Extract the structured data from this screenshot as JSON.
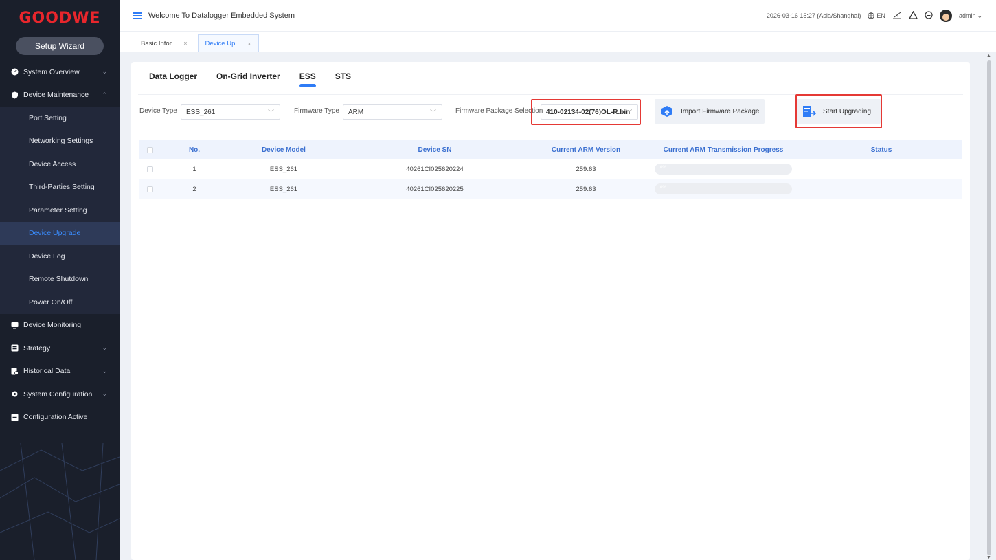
{
  "brand": {
    "logo": "GOODWE",
    "setup_wizard": "Setup Wizard"
  },
  "sidebar": {
    "items": [
      {
        "label": "System Overview",
        "icon": "speedometer-icon",
        "chevron": "⌄"
      },
      {
        "label": "Device Maintenance",
        "icon": "shield-icon",
        "chevron": "⌃"
      }
    ],
    "maintenance_sub": [
      "Port Setting",
      "Networking Settings",
      "Device Access",
      "Third-Parties Setting",
      "Parameter Setting",
      "Device Upgrade",
      "Device Log",
      "Remote Shutdown",
      "Power On/Off"
    ],
    "lower_items": [
      {
        "label": "Device Monitoring",
        "icon": "monitor-icon",
        "chevron": ""
      },
      {
        "label": "Strategy",
        "icon": "strategy-icon",
        "chevron": "⌄"
      },
      {
        "label": "Historical Data",
        "icon": "history-icon",
        "chevron": "⌄"
      },
      {
        "label": "System Configuration",
        "icon": "gear-icon",
        "chevron": "⌄"
      },
      {
        "label": "Configuration Active",
        "icon": "config-icon",
        "chevron": ""
      }
    ]
  },
  "header": {
    "title": "Welcome To Datalogger Embedded System",
    "datetime": "2026-03-16 15:27 (Asia/Shanghai)",
    "language": "EN",
    "user": "admin"
  },
  "tabs": [
    {
      "label": "Basic Infor...",
      "close": "×"
    },
    {
      "label": "Device Up...",
      "close": "×"
    }
  ],
  "subtabs": [
    "Data Logger",
    "On-Grid Inverter",
    "ESS",
    "STS"
  ],
  "filters": {
    "device_type_label": "Device Type",
    "device_type_value": "ESS_261",
    "firmware_type_label": "Firmware Type",
    "firmware_type_value": "ARM",
    "package_label": "Firmware Package Selection",
    "package_value": "410-02134-02(76)OL-R.bin",
    "import_button": "Import Firmware Package",
    "start_button": "Start Upgrading"
  },
  "table": {
    "headers": [
      "No.",
      "Device Model",
      "Device SN",
      "Current ARM Version",
      "Current ARM Transmission Progress",
      "Status"
    ],
    "rows": [
      {
        "no": "1",
        "model": "ESS_261",
        "sn": "40261CI025620224",
        "arm": "259.63",
        "progress": 0.0,
        "progress_text": "0%",
        "status": ""
      },
      {
        "no": "2",
        "model": "ESS_261",
        "sn": "40261CI025620225",
        "arm": "259.63",
        "progress": 0.0,
        "progress_text": "0%",
        "status": ""
      }
    ]
  },
  "colors": {
    "accent": "#2f7cf6",
    "sidebar": "#1a1f2b",
    "highlight": "#e53935",
    "brand": "#e8262c"
  }
}
